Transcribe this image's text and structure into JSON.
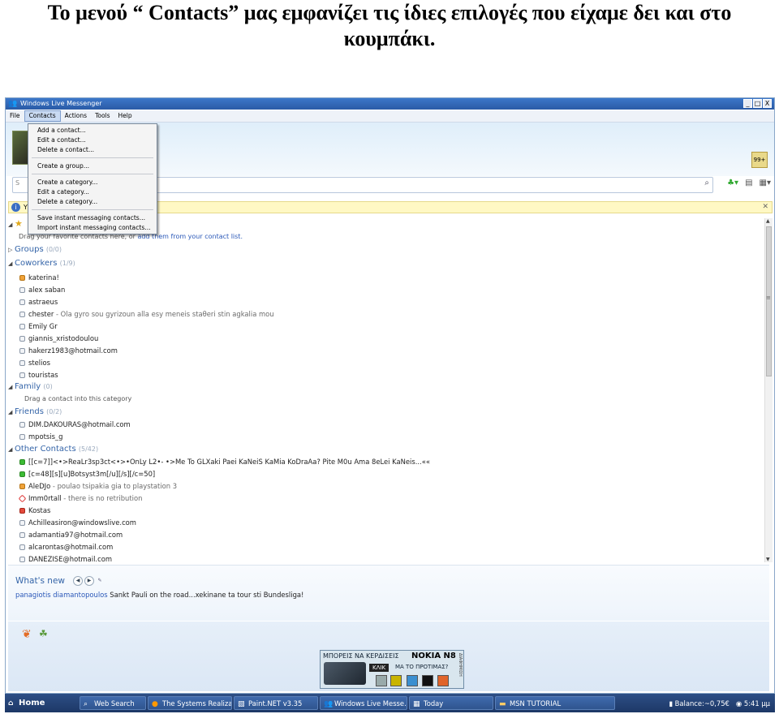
{
  "heading": "Το μενού “ Contacts” μας εμφανίζει τις ίδιες επιλογές που είχαμε δει και στο κουμπάκι.",
  "window": {
    "title": "Windows Live Messenger",
    "controls": [
      "_",
      "□",
      "X"
    ]
  },
  "menubar": [
    "File",
    "Contacts",
    "Actions",
    "Tools",
    "Help"
  ],
  "contacts_menu": [
    "Add a contact...",
    "Edit a contact...",
    "Delete a contact...",
    "Create a group...",
    "Create a category...",
    "Edit a category...",
    "Delete a category...",
    "Save instant messaging contacts...",
    "Import instant messaging contacts..."
  ],
  "search": {
    "placeholder": "S"
  },
  "infobar": {
    "text": "Y"
  },
  "favorites": {
    "hint_before": "Drag your favorite contacts here, or ",
    "hint_link": "add them from your contact list."
  },
  "categories": {
    "groups": {
      "name": "Groups",
      "count": "(0/0)"
    },
    "coworkers": {
      "name": "Coworkers",
      "count": "(1/9)",
      "contacts": [
        {
          "name": "katerina!",
          "status": "away"
        },
        {
          "name": "alex saban",
          "status": "offline"
        },
        {
          "name": "astraeus",
          "status": "offline"
        },
        {
          "name": "chester",
          "message": " - Ola gyro sou gyrizoun alla esy meneis staθeri stin agkalia mou",
          "status": "offline"
        },
        {
          "name": "Emily Gr",
          "status": "offline"
        },
        {
          "name": "giannis_xristodoulou",
          "status": "offline"
        },
        {
          "name": "hakerz1983@hotmail.com",
          "status": "offline"
        },
        {
          "name": "stelios",
          "status": "offline"
        },
        {
          "name": "touristas",
          "status": "offline"
        }
      ]
    },
    "family": {
      "name": "Family",
      "count": "(0)",
      "hint": "Drag a contact into this category"
    },
    "friends": {
      "name": "Friends",
      "count": "(0/2)",
      "contacts": [
        {
          "name": "DIM.DAKOURAS@hotmail.com",
          "status": "offline"
        },
        {
          "name": "mpotsis_g",
          "status": "offline"
        }
      ]
    },
    "other": {
      "name": "Other Contacts",
      "count": "(5/42)",
      "contacts": [
        {
          "name": "[[c=7]]<•>ReaLr3sp3ct<•>•OnLy L2•- •>Me To GLXaki Paei KaNeiS KaMia KoDraAa? Pite M0u Ama 8eLei KaNeis...««",
          "status": "online"
        },
        {
          "name": "[c=48][s][u]Botsyst3m[/u][/s][/c=50]",
          "status": "online"
        },
        {
          "name": "AleDJo",
          "message": " - poulao tsipakia gia to playstation 3",
          "status": "away"
        },
        {
          "name": "Imm0rtall",
          "message": " - there is no retribution",
          "status": "blocked"
        },
        {
          "name": "Kostas",
          "status": "busy"
        },
        {
          "name": "Achilleasiron@windowslive.com",
          "status": "offline"
        },
        {
          "name": "adamantia97@hotmail.com",
          "status": "offline"
        },
        {
          "name": "alcarontas@hotmail.com",
          "status": "offline"
        },
        {
          "name": "DANEZISE@hotmail.com",
          "status": "offline"
        }
      ]
    }
  },
  "whats_new": {
    "title": "What's new",
    "news_user": "panagiotis diamantopoulos",
    "news_text": " Sankt Pauli on the road...xekinane ta tour sti Bundesliga!"
  },
  "ad": {
    "text1": "ΜΠΟΡΕΙΣ ΝΑ ΚΕΡΔΙΣΕΙΣ",
    "brand": "NOKIA N8",
    "click": "ΚΛΙΚ",
    "text2": "ΜΑ ΤΟ ΠΡΟΤΙΜΑΣ?",
    "side": "ΔΙΑΦΗΜΙΣΗ"
  },
  "taskbar": {
    "items": [
      "Home",
      "Web Search",
      "The Systems Realizat...",
      "Paint.NET v3.35",
      "Windows Live Messe...",
      "Today",
      "MSN TUTORIAL"
    ],
    "balance": "Balance:~0,75€",
    "clock": "5:41 μμ"
  }
}
